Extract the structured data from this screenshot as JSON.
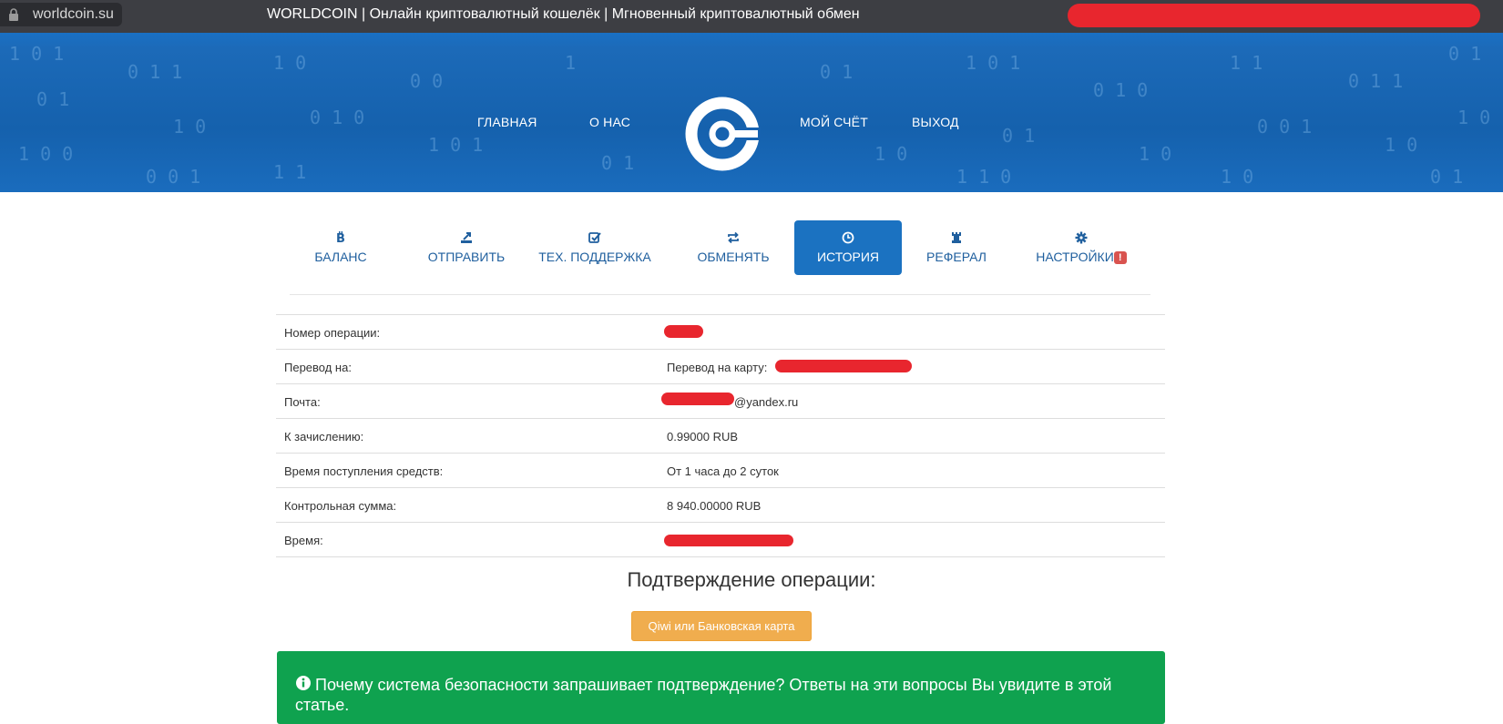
{
  "browser": {
    "url": "worldcoin.su",
    "title": "WORLDCOIN | Онлайн криптовалютный кошелёк | Мгновенный криптовалютный обмен"
  },
  "nav": {
    "left": [
      "ГЛАВНАЯ",
      "О НАС"
    ],
    "right": [
      "МОЙ СЧЁТ",
      "ВЫХОД"
    ]
  },
  "tabs": [
    {
      "label": "БАЛАНС",
      "icon": "bitcoin-icon"
    },
    {
      "label": "ОТПРАВИТЬ",
      "icon": "send-icon"
    },
    {
      "label": "ТЕХ. ПОДДЕРЖКА",
      "icon": "check-square-icon"
    },
    {
      "label": "ОБМЕНЯТЬ",
      "icon": "exchange-icon"
    },
    {
      "label": "ИСТОРИЯ",
      "icon": "clock-icon",
      "active": true
    },
    {
      "label": "РЕФЕРАЛ",
      "icon": "chess-rook-icon"
    },
    {
      "label": "НАСТРОЙКИ",
      "icon": "gear-icon",
      "badge": "!"
    }
  ],
  "details": {
    "operation_number": {
      "label": "Номер операции:"
    },
    "transfer_to": {
      "label": "Перевод на:",
      "value": "Перевод на карту:"
    },
    "email": {
      "label": "Почта:",
      "value_suffix": "@yandex.ru"
    },
    "credit": {
      "label": "К зачислению:",
      "value": "0.99000 RUB"
    },
    "arrival_time": {
      "label": "Время поступления средств:",
      "value": "От 1 часа до 2 суток"
    },
    "checksum": {
      "label": "Контрольная сумма:",
      "value": "8 940.00000 RUB"
    },
    "time": {
      "label": "Время:"
    }
  },
  "confirm": {
    "title": "Подтверждение операции:",
    "button_label": "Qiwi или Банковская карта"
  },
  "info": {
    "text": "Почему система безопасности запрашивает подтверждение? Ответы на эти вопросы Вы увидите в этой статье."
  },
  "colors": {
    "header_blue": "#1561ad",
    "active_tab": "#1b72c1",
    "tab_text": "#1f5f9e",
    "button_orange": "#f0ad4e",
    "info_green": "#0fa24f",
    "redaction_red": "#e8262e"
  }
}
